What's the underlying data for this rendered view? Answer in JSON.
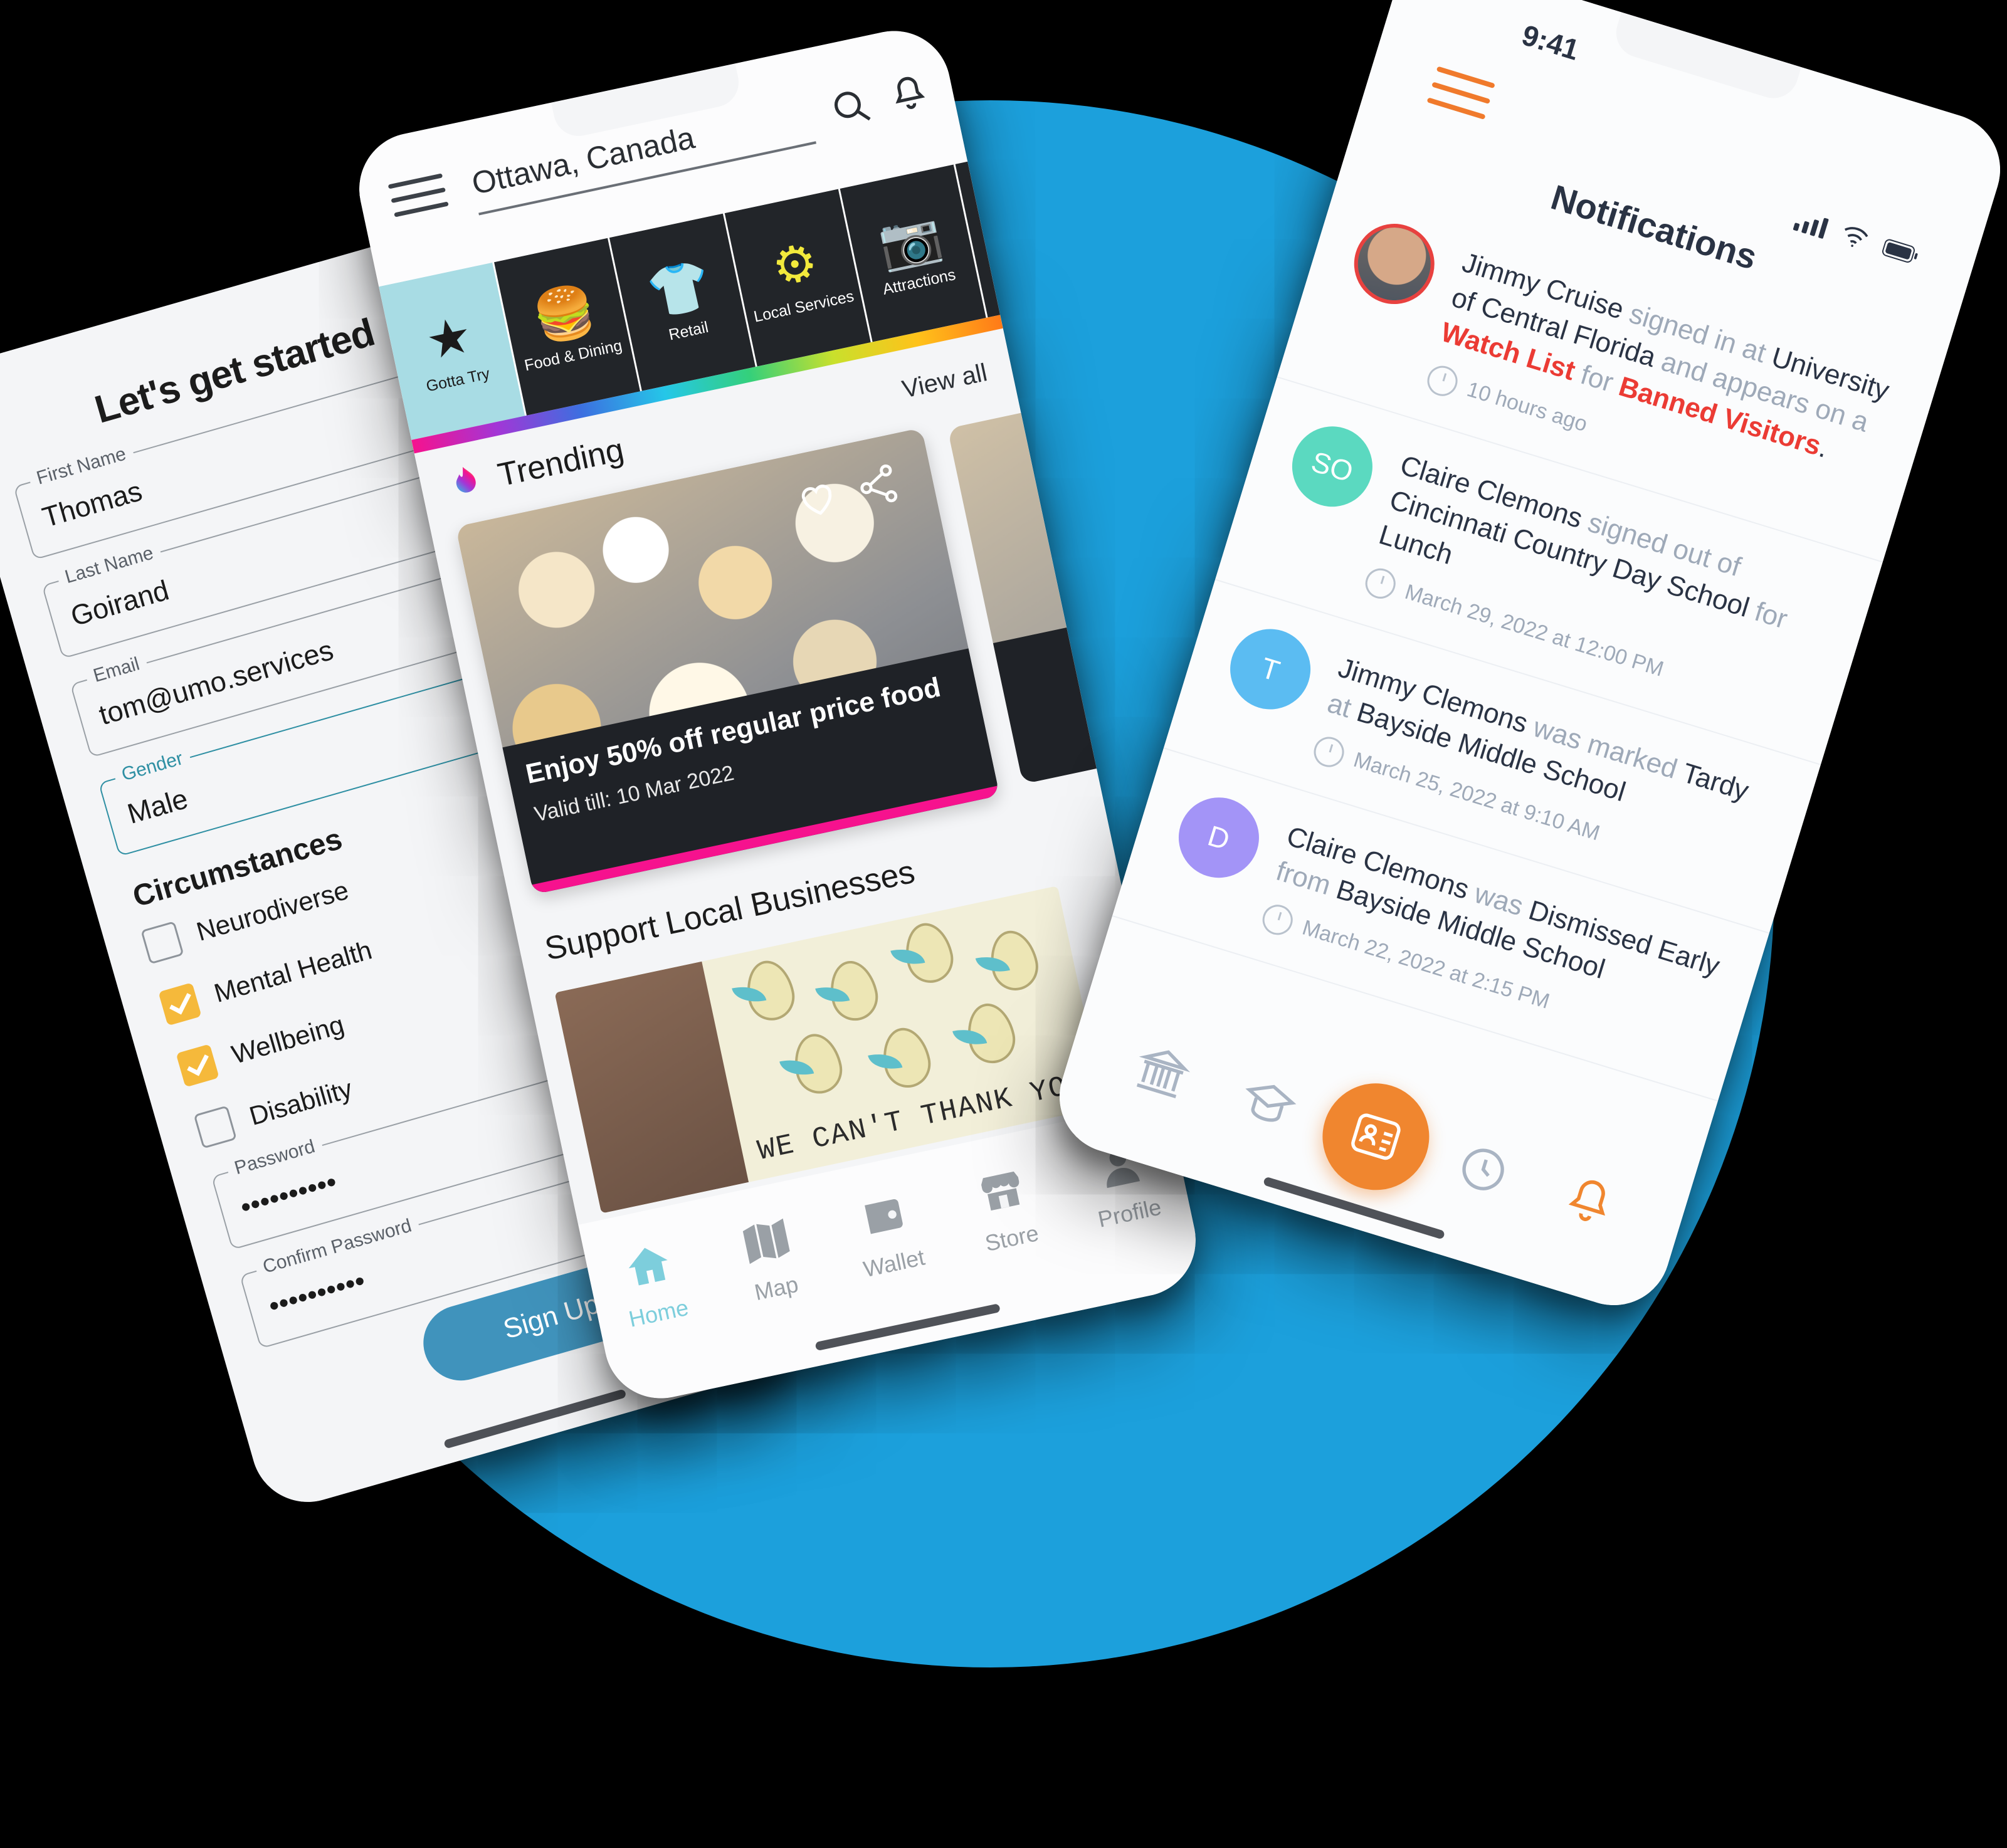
{
  "background": {
    "disc_color": "#1CA0DC",
    "page_bg": "#000000"
  },
  "signup_phone": {
    "title": "Let's get started",
    "fields": [
      {
        "label": "First Name",
        "value": "Thomas",
        "focused": false
      },
      {
        "label": "Last Name",
        "value": "Goirand",
        "focused": false
      },
      {
        "label": "Email",
        "value": "tom@umo.services",
        "focused": false
      },
      {
        "label": "Gender",
        "value": "Male",
        "focused": true
      },
      {
        "label": "Password",
        "value": "••••••••••",
        "focused": false
      },
      {
        "label": "Confirm Password",
        "value": "••••••••••",
        "focused": false
      }
    ],
    "section_title": "Circumstances",
    "checkboxes": [
      {
        "label": "Neurodiverse",
        "checked": false
      },
      {
        "label": "Mental Health",
        "checked": true
      },
      {
        "label": "Wellbeing",
        "checked": true
      },
      {
        "label": "Disability",
        "checked": false
      }
    ],
    "submit_label": "Sign Up",
    "accent_checkbox": "#F5B93B",
    "accent_button": "#4093BC"
  },
  "directory_phone": {
    "search_value": "Ottawa, Canada",
    "search_placeholder": "Search",
    "categories": [
      {
        "label": "Gotta Try",
        "icon": "star-icon",
        "glyph": "★",
        "color": "#1b1b1b",
        "bg": "#A8DCE4"
      },
      {
        "label": "Food &  Dining",
        "icon": "burger-icon",
        "glyph": "🍔",
        "color": "#F6128E",
        "bg": "#222529"
      },
      {
        "label": "Retail",
        "icon": "tshirt-icon",
        "glyph": "👕",
        "color": "#5BE43C",
        "bg": "#222529"
      },
      {
        "label": "Local Services",
        "icon": "gear-wrench-icon",
        "glyph": "⚙",
        "color": "#F2E93C",
        "bg": "#222529"
      },
      {
        "label": "Attractions",
        "icon": "camera-icon",
        "glyph": "📷",
        "color": "#F76B78",
        "bg": "#222529"
      }
    ],
    "trending": {
      "heading": "Trending",
      "view_all": "View all",
      "icon": "flame-icon"
    },
    "promo": {
      "title": "Enjoy 50% off regular price food",
      "valid": "Valid till: 10 Mar 2022",
      "like_icon": "heart-icon",
      "share_icon": "share-icon"
    },
    "local_heading": "Support Local Businesses",
    "local_card_text": "WE CAN'T THANK YOU",
    "nav": [
      {
        "label": "Home",
        "icon": "home-icon",
        "active": true
      },
      {
        "label": "Map",
        "icon": "map-icon",
        "active": false
      },
      {
        "label": "Wallet",
        "icon": "wallet-icon",
        "active": false
      },
      {
        "label": "Store",
        "icon": "store-icon",
        "active": false
      },
      {
        "label": "Profile",
        "icon": "profile-icon",
        "active": false
      }
    ]
  },
  "notifications_phone": {
    "status_time": "9:41",
    "title": "Notifications",
    "menu_icon": "hamburger-icon",
    "status_icons": [
      "signal-icon",
      "wifi-icon",
      "battery-icon"
    ],
    "accent": "#F0862F",
    "items": [
      {
        "avatar_type": "photo",
        "avatar_initials": "",
        "avatar_color": "#E8413F",
        "pre": "Jimmy Cruise",
        "mid1": " signed in at ",
        "place": "University of Central Florida",
        "mid2": " and appears on a ",
        "warn1": "Watch List",
        "mid3": " for ",
        "warn2": "Banned Visitors",
        "tail": ".",
        "time": "10 hours ago"
      },
      {
        "avatar_type": "initials",
        "avatar_initials": "SO",
        "avatar_color": "#5BD9C0",
        "pre": "Claire Clemons",
        "mid1": " signed out of ",
        "place": "Cincinnati Country Day School",
        "mid2": " for ",
        "warn1": "",
        "mid3": "",
        "warn2": "",
        "tail": "Lunch",
        "time": "March 29, 2022 at 12:00 PM"
      },
      {
        "avatar_type": "initials",
        "avatar_initials": "T",
        "avatar_color": "#5BBCF2",
        "pre": "Jimmy Clemons",
        "mid1": " was marked ",
        "place": "Tardy",
        "mid2": " at ",
        "warn1": "",
        "mid3": "",
        "warn2": "",
        "tail": "Bayside Middle School",
        "time": "March 25, 2022 at 9:10 AM"
      },
      {
        "avatar_type": "initials",
        "avatar_initials": "D",
        "avatar_color": "#A394F7",
        "pre": "Claire Clemons",
        "mid1": " was ",
        "place": "Dismissed Early",
        "mid2": " from ",
        "warn1": "",
        "mid3": "",
        "warn2": "",
        "tail": "Bayside Middle School",
        "time": "March 22, 2022 at 2:15 PM"
      }
    ],
    "nav": [
      {
        "icon": "building-icon",
        "active": false
      },
      {
        "icon": "graduation-cap-icon",
        "active": false
      },
      {
        "icon": "id-badge-icon",
        "active": true
      },
      {
        "icon": "clock-icon",
        "active": false
      },
      {
        "icon": "bell-icon",
        "active": true
      }
    ]
  }
}
